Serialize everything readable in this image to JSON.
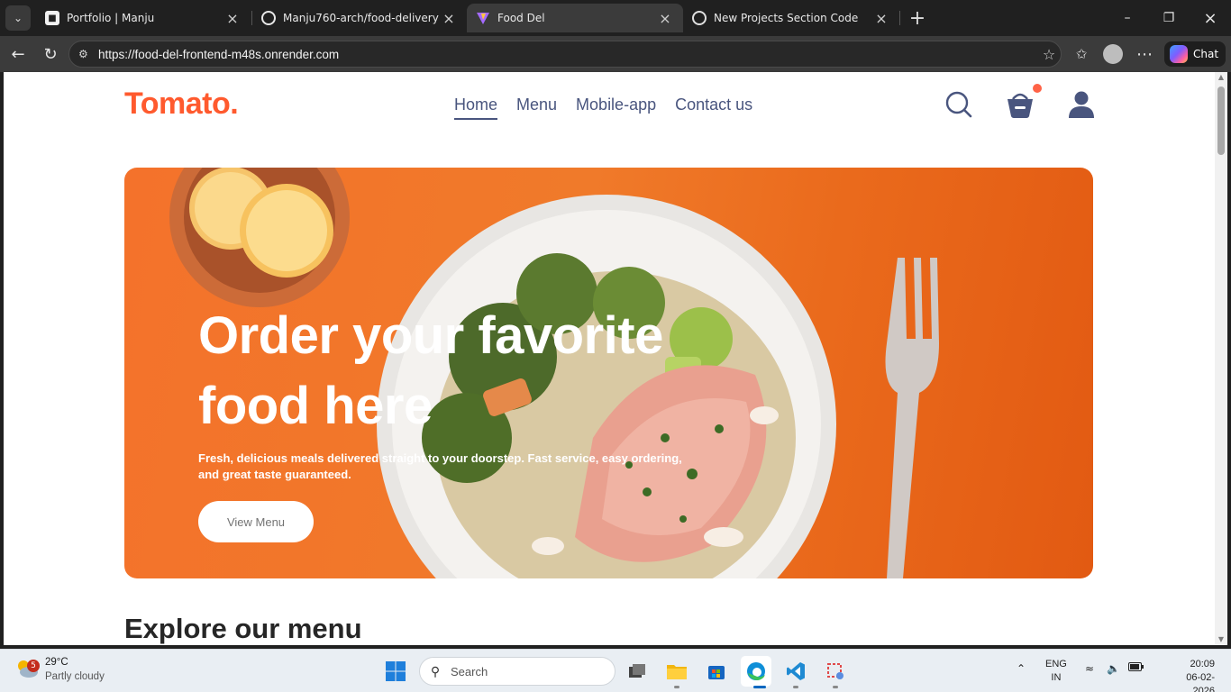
{
  "browser": {
    "tabs": [
      {
        "title": "Portfolio | Manju",
        "active": false
      },
      {
        "title": "Manju760-arch/food-delivery",
        "active": false
      },
      {
        "title": "Food Del",
        "active": true
      },
      {
        "title": "New Projects Section Code",
        "active": false
      }
    ],
    "url": "https://food-del-frontend-m48s.onrender.com",
    "chat_label": "Chat"
  },
  "site": {
    "logo": "Tomato.",
    "nav": [
      {
        "label": "Home",
        "active": true
      },
      {
        "label": "Menu",
        "active": false
      },
      {
        "label": "Mobile-app",
        "active": false
      },
      {
        "label": "Contact us",
        "active": false
      }
    ],
    "hero": {
      "title": "Order your favorite food here",
      "subtitle": "Fresh, delicious meals delivered straight to your doorstep. Fast service, easy ordering, and great taste guaranteed.",
      "button": "View Menu"
    },
    "explore_heading": "Explore our menu",
    "colors": {
      "brand": "#ff5a2e",
      "nav": "#49557e",
      "cart_dot": "#ff6347"
    }
  },
  "taskbar": {
    "weather": {
      "temp": "29°C",
      "condition": "Partly cloudy",
      "badge": "5"
    },
    "search_placeholder": "Search",
    "language": {
      "line1": "ENG",
      "line2": "IN"
    },
    "clock": {
      "time": "20:09",
      "date": "06-02-2026"
    }
  }
}
